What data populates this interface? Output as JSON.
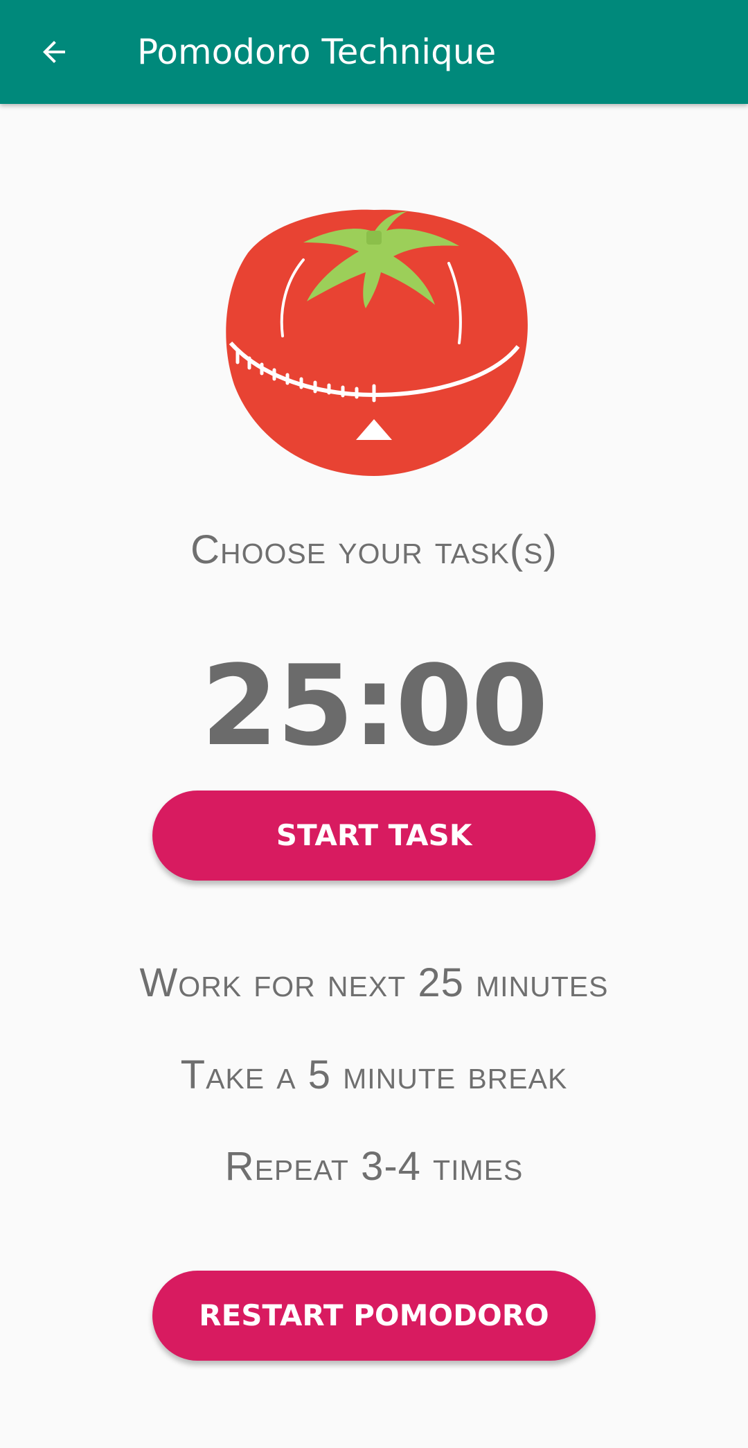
{
  "appbar": {
    "title": "Pomodoro Technique",
    "back_icon": "arrow-left-icon",
    "color": "#00897b"
  },
  "image": {
    "icon": "tomato-timer-icon"
  },
  "main": {
    "prompt": "Choose your task(s)",
    "timer": "25:00",
    "start_button": "START TASK",
    "steps": [
      "Work for next 25 minutes",
      "Take a 5 minute break",
      "Repeat 3-4 times"
    ],
    "restart_button": "RESTART POMODORO"
  },
  "colors": {
    "accent": "#d81b60",
    "text": "#6f6f6f",
    "background": "#fafafa"
  }
}
